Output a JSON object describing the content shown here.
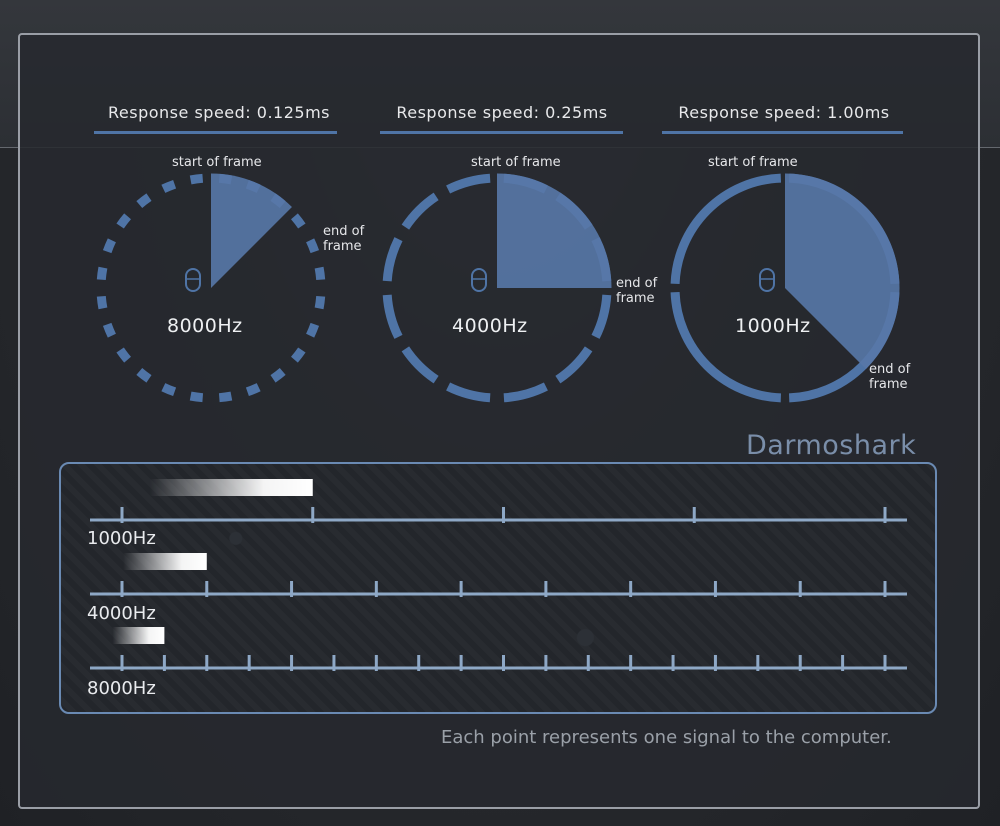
{
  "speeds": [
    {
      "label": "Response speed: 0.125ms"
    },
    {
      "label": "Response speed: 0.25ms"
    },
    {
      "label": "Response speed: 1.00ms"
    }
  ],
  "dials": [
    {
      "rate": "8000Hz",
      "start_label": "start of frame",
      "end_label_1": "end of",
      "end_label_2": "frame",
      "fraction": 0.125,
      "mouse_icon": "mouse-icon"
    },
    {
      "rate": "4000Hz",
      "start_label": "start of frame",
      "end_label_1": "end of",
      "end_label_2": "frame",
      "fraction": 0.25,
      "mouse_icon": "mouse-icon"
    },
    {
      "rate": "1000Hz",
      "start_label": "start of frame",
      "end_label_1": "end of",
      "end_label_2": "frame",
      "fraction": 0.375,
      "mouse_icon": "mouse-icon"
    }
  ],
  "brand": "Darmoshark",
  "timeline": {
    "rows": [
      {
        "label": "1000Hz",
        "ticks": 5
      },
      {
        "label": "4000Hz",
        "ticks": 10
      },
      {
        "label": "8000Hz",
        "ticks": 19
      }
    ]
  },
  "caption": "Each point represents one signal to the computer.",
  "colors": {
    "accent": "#4f74a6",
    "fill": "#5878a8",
    "line": "#8ea8c6"
  }
}
